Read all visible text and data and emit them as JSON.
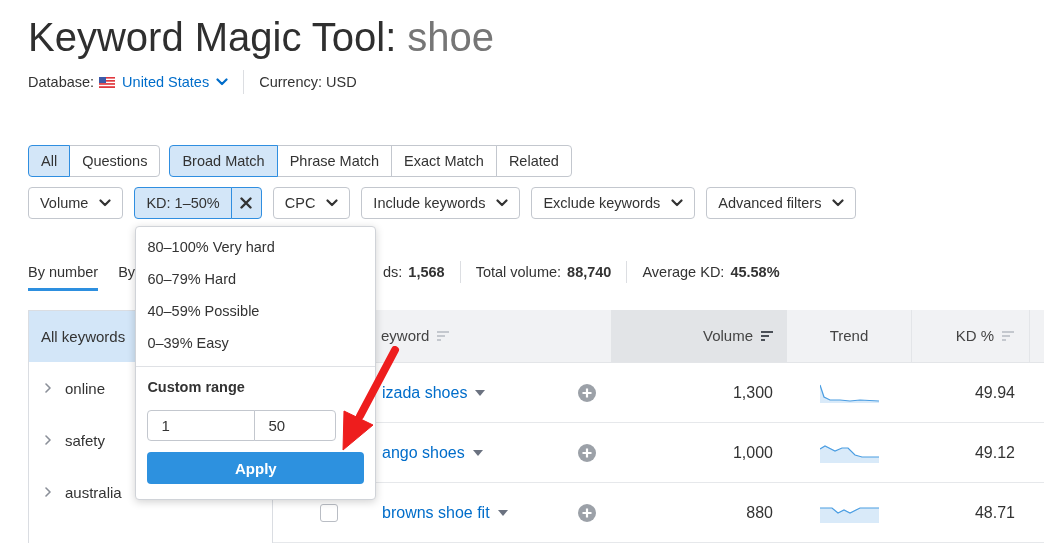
{
  "header": {
    "title": "Keyword Magic Tool:",
    "query": "shoe"
  },
  "meta": {
    "database_label": "Database:",
    "database": "United States",
    "currency": "Currency: USD"
  },
  "tab_groups": [
    {
      "tabs": [
        {
          "label": "All",
          "selected": true
        },
        {
          "label": "Questions",
          "selected": false
        }
      ]
    },
    {
      "tabs": [
        {
          "label": "Broad Match",
          "selected": true
        },
        {
          "label": "Phrase Match",
          "selected": false
        },
        {
          "label": "Exact Match",
          "selected": false
        },
        {
          "label": "Related",
          "selected": false
        }
      ]
    }
  ],
  "filters": [
    {
      "label": "Volume",
      "active": false
    },
    {
      "label": "KD: 1–50%",
      "active": true,
      "menu": {
        "options": [
          "80–100% Very hard",
          "60–79% Hard",
          "40–59% Possible",
          "0–39% Easy"
        ],
        "custom_range": {
          "title": "Custom range",
          "from": "1",
          "to": "50",
          "button": "Apply"
        }
      }
    },
    {
      "label": "CPC",
      "active": false
    },
    {
      "label": "Include keywords",
      "active": false
    },
    {
      "label": "Exclude keywords",
      "active": false
    },
    {
      "label": "Advanced filters",
      "active": false
    }
  ],
  "view_tabs": [
    {
      "label": "By number",
      "selected": true
    },
    {
      "label": "By",
      "selected": false
    }
  ],
  "stats": [
    {
      "label": "ds:",
      "value": "1,568"
    },
    {
      "label": "Total volume:",
      "value": "88,740"
    },
    {
      "label": "Average KD:",
      "value": "45.58%"
    }
  ],
  "sidebar": {
    "items": [
      {
        "kind": "total",
        "label": "All keywords",
        "selected": true
      },
      {
        "kind": "group",
        "label": "online",
        "selected": false,
        "expanded": false
      },
      {
        "kind": "group",
        "label": "safety",
        "selected": false,
        "expanded": false
      },
      {
        "kind": "group",
        "label": "australia",
        "selected": false,
        "expanded": false
      }
    ]
  },
  "table": {
    "columns": [
      {
        "label": "eyword",
        "sortable": true,
        "sorted": false
      },
      {
        "label": "Volume",
        "sortable": true,
        "sorted": true
      },
      {
        "label": "Trend",
        "sortable": false,
        "sorted": false
      },
      {
        "label": "KD %",
        "sortable": true,
        "sorted": false
      }
    ],
    "rows": [
      {
        "keyword": "izada shoes",
        "volume": "1,300",
        "kd": "49.94"
      },
      {
        "keyword": "ango shoes",
        "volume": "1,000",
        "kd": "49.12"
      },
      {
        "keyword": "browns shoe fit",
        "volume": "880",
        "kd": "48.71",
        "checked": false
      }
    ]
  }
}
